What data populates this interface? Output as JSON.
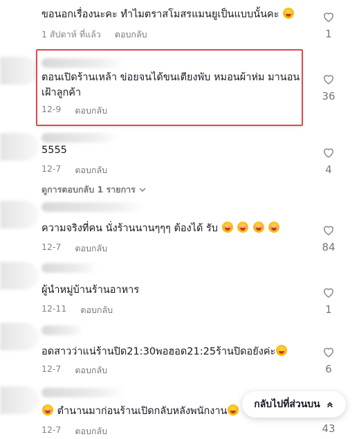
{
  "comments": [
    {
      "text": "ขอนอกเรื่องนะคะ ทำไมตราสโมสรแมนยูเป็นแบบนั้นคะ",
      "emoji": "laugh-emoji",
      "date": "1 สัปดาห์ ที่แล้ว",
      "reply": "ตอบกลับ",
      "likes": "1"
    },
    {
      "text": "ตอนเปิดร้านเหล้า ข่อยจนได้ขนเตียงพับ หมอนผ้าห่ม มานอนเฝ้าลูกค้า",
      "date": "12-9",
      "reply": "ตอบกลับ",
      "likes": "36"
    },
    {
      "text": "5555",
      "date": "12-7",
      "reply": "ตอบกลับ",
      "likes": "4",
      "view_replies": "ดูการตอบกลับ 1 รายการ"
    },
    {
      "text": "ความจริงที่คน นั่งร้านนานๆๆๆ ต้องได้ รับ",
      "emoji": "blush-emoji x4",
      "date": "12-7",
      "reply": "ตอบกลับ",
      "likes": "84"
    },
    {
      "text": "ผู้นำหมู่บ้านร้านอาหาร",
      "date": "12-11",
      "reply": "ตอบกลับ",
      "likes": "1"
    },
    {
      "text": "อดสาวว่าแน่ร้านปิด21:30พอฮอด21:25ร้านปิดอยังค่ะ",
      "emoji": "laugh-emoji",
      "date": "12-7",
      "reply": "ตอบกลับ",
      "likes": "6"
    },
    {
      "text": "ตำนานมาก่อนร้านเปิดกลับหลังพนักงาน",
      "emoji": "blush-emoji, salute-emoji",
      "date": "12-7",
      "reply": "ตอบกลับ",
      "likes": "43"
    }
  ],
  "back_to_top": "กลับไปที่ส่วนบน",
  "colors": {
    "highlight": "#e0474c",
    "text": "#161823",
    "muted": "#8a8b91"
  },
  "icons": {
    "like": "heart-outline-icon",
    "view_replies": "chevron-down-icon",
    "back_to_top": "chevron-up-icon"
  }
}
